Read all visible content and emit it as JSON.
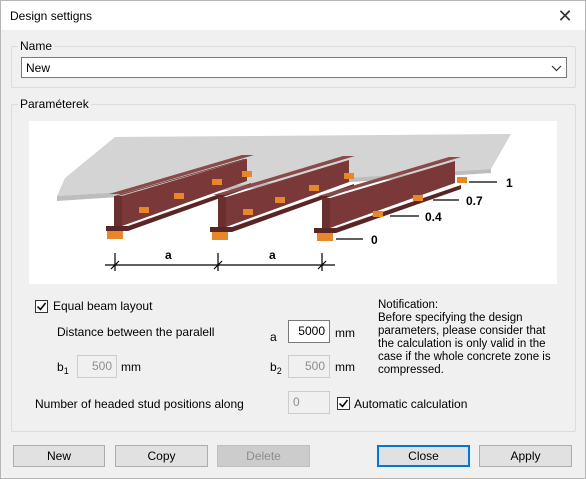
{
  "window": {
    "title": "Design settigns",
    "close_glyph": "✕"
  },
  "name_group": {
    "label": "Name",
    "value": "New"
  },
  "params_group": {
    "label": "Paraméterek"
  },
  "figure": {
    "dimension_label_left": "a",
    "dimension_label_right": "a",
    "positions": [
      "1",
      "0.7",
      "0.4",
      "0"
    ]
  },
  "equal_layout": {
    "label": "Equal beam layout",
    "checked": true
  },
  "distance": {
    "label": "Distance between the paralell",
    "var": "a",
    "value": "5000",
    "unit": "mm"
  },
  "b1": {
    "label_b": "b",
    "sub": "1",
    "value": "500",
    "unit": "mm"
  },
  "b2": {
    "label_b": "b",
    "sub": "2",
    "value": "500",
    "unit": "mm"
  },
  "studs": {
    "label": "Number of headed stud positions along",
    "value": "0"
  },
  "auto_calc": {
    "label": "Automatic calculation",
    "checked": true
  },
  "notification": {
    "title": "Notification:",
    "text": "Before specifying the design parameters, please consider that the calculation is only valid in the case if the whole concrete zone is compressed."
  },
  "buttons": {
    "new": "New",
    "copy": "Copy",
    "delete": "Delete",
    "close": "Close",
    "apply": "Apply"
  },
  "colors": {
    "accent": "#0078d7",
    "beam": "#7a3a3a",
    "stud": "#e8872a",
    "slab": "#d0d0d0"
  }
}
